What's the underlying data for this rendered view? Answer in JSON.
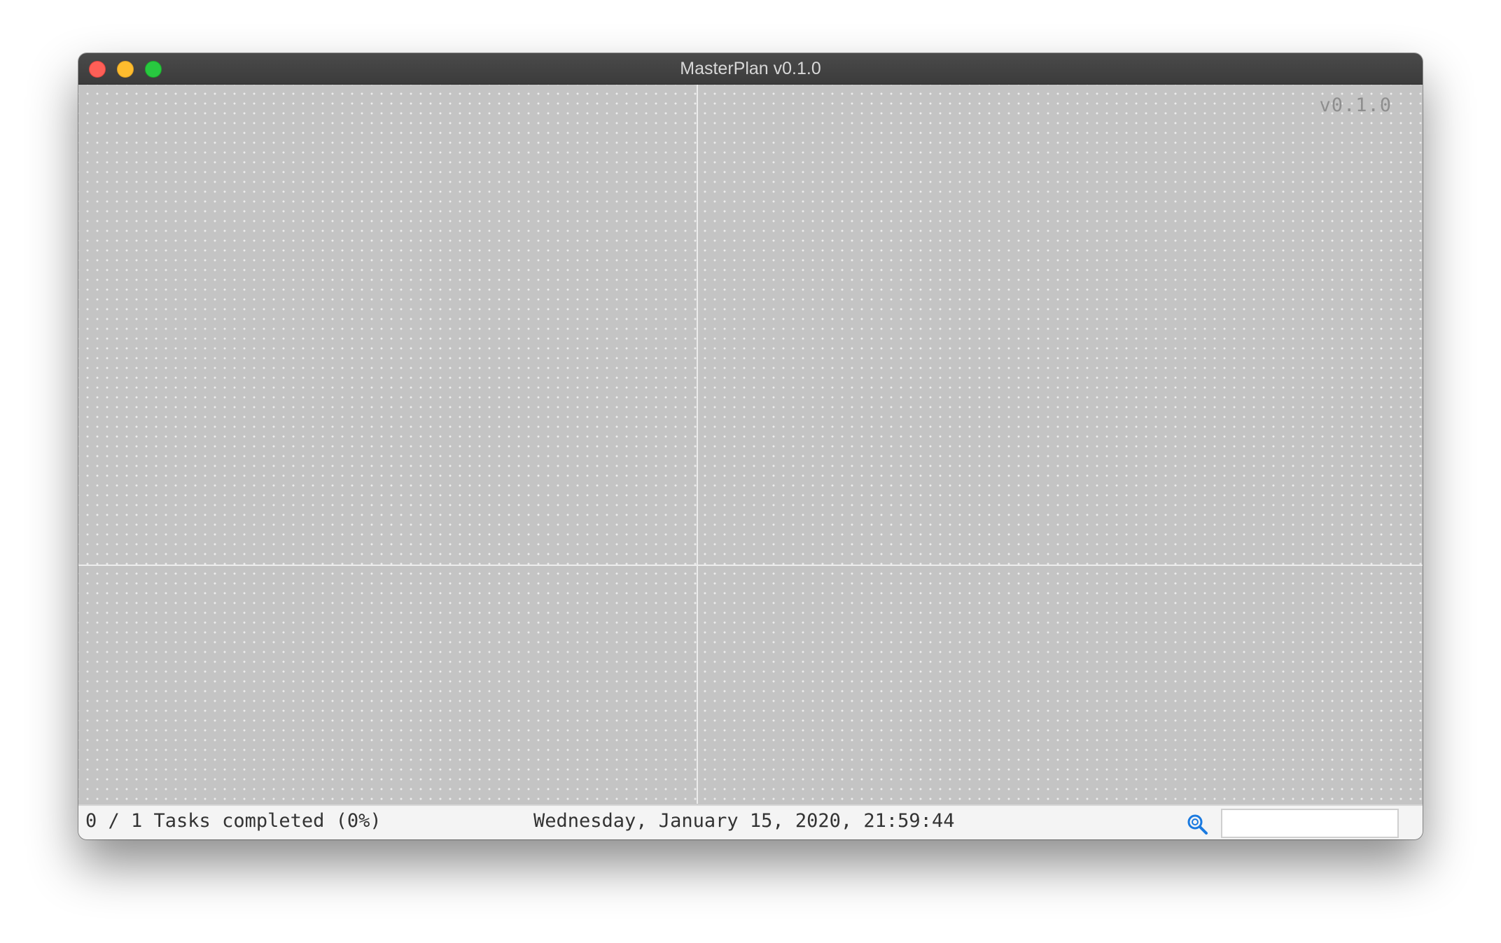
{
  "window": {
    "title": "MasterPlan v0.1.0"
  },
  "canvas": {
    "version_label": "v0.1.0"
  },
  "statusbar": {
    "task_summary": "0 / 1 Tasks completed (0%)",
    "datetime": "Wednesday, January 15, 2020, 21:59:44",
    "search": {
      "value": "",
      "placeholder": ""
    }
  },
  "icons": {
    "search": "search-icon"
  },
  "colors": {
    "canvas_bg": "#c4c4c4",
    "accent_search_icon": "#1a7ae0",
    "close": "#fe5f57",
    "minimize": "#febc2e",
    "zoom": "#28c840"
  }
}
